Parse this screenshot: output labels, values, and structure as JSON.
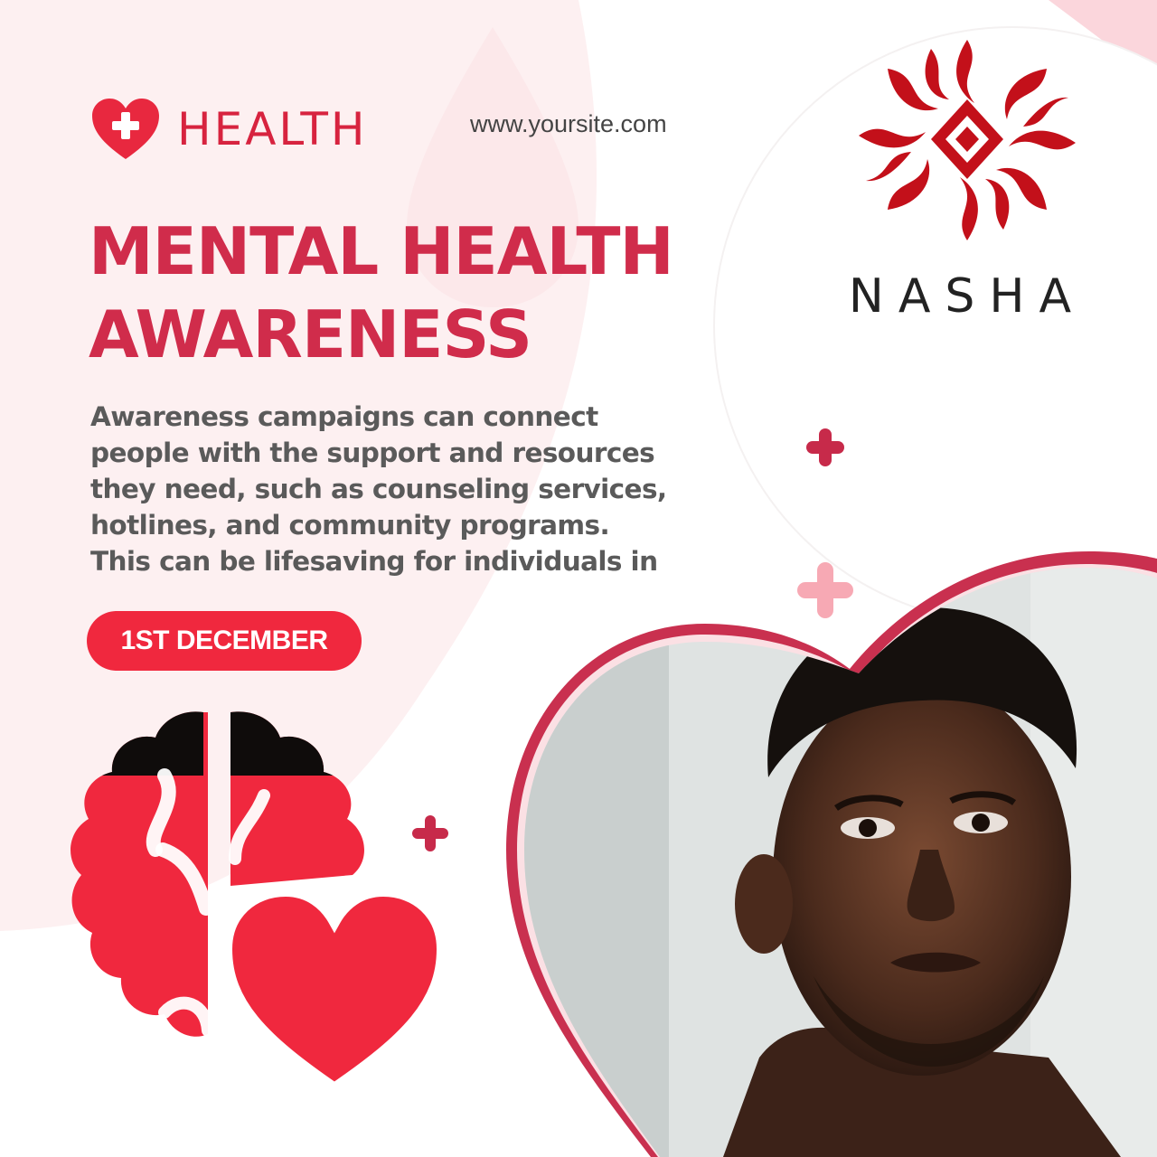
{
  "brand": {
    "label": "HEALTH",
    "icon": "heart-plus-icon"
  },
  "website": "www.yoursite.com",
  "title_lines": [
    "MENTAL HEALTH",
    "AWARENESS"
  ],
  "body_lines": [
    "Awareness campaigns can connect",
    "people with the support and resources",
    "they need, such as counseling services,",
    "hotlines, and community programs.",
    "This can be lifesaving for individuals in"
  ],
  "date_label": "1ST DECEMBER",
  "logo": {
    "wordmark": "NASHA",
    "emblem": "flame-sun-emblem"
  },
  "colors": {
    "accent": "#d02c4b",
    "bright_red": "#f0283e",
    "pink": "#f7a9b4",
    "text_gray": "#5a5a5a",
    "bg_pink": "#fdeff0"
  },
  "illustration": {
    "icon": "brain-heart-icon"
  },
  "photo": {
    "subject": "portrait-photo",
    "frame": "heart-frame"
  }
}
